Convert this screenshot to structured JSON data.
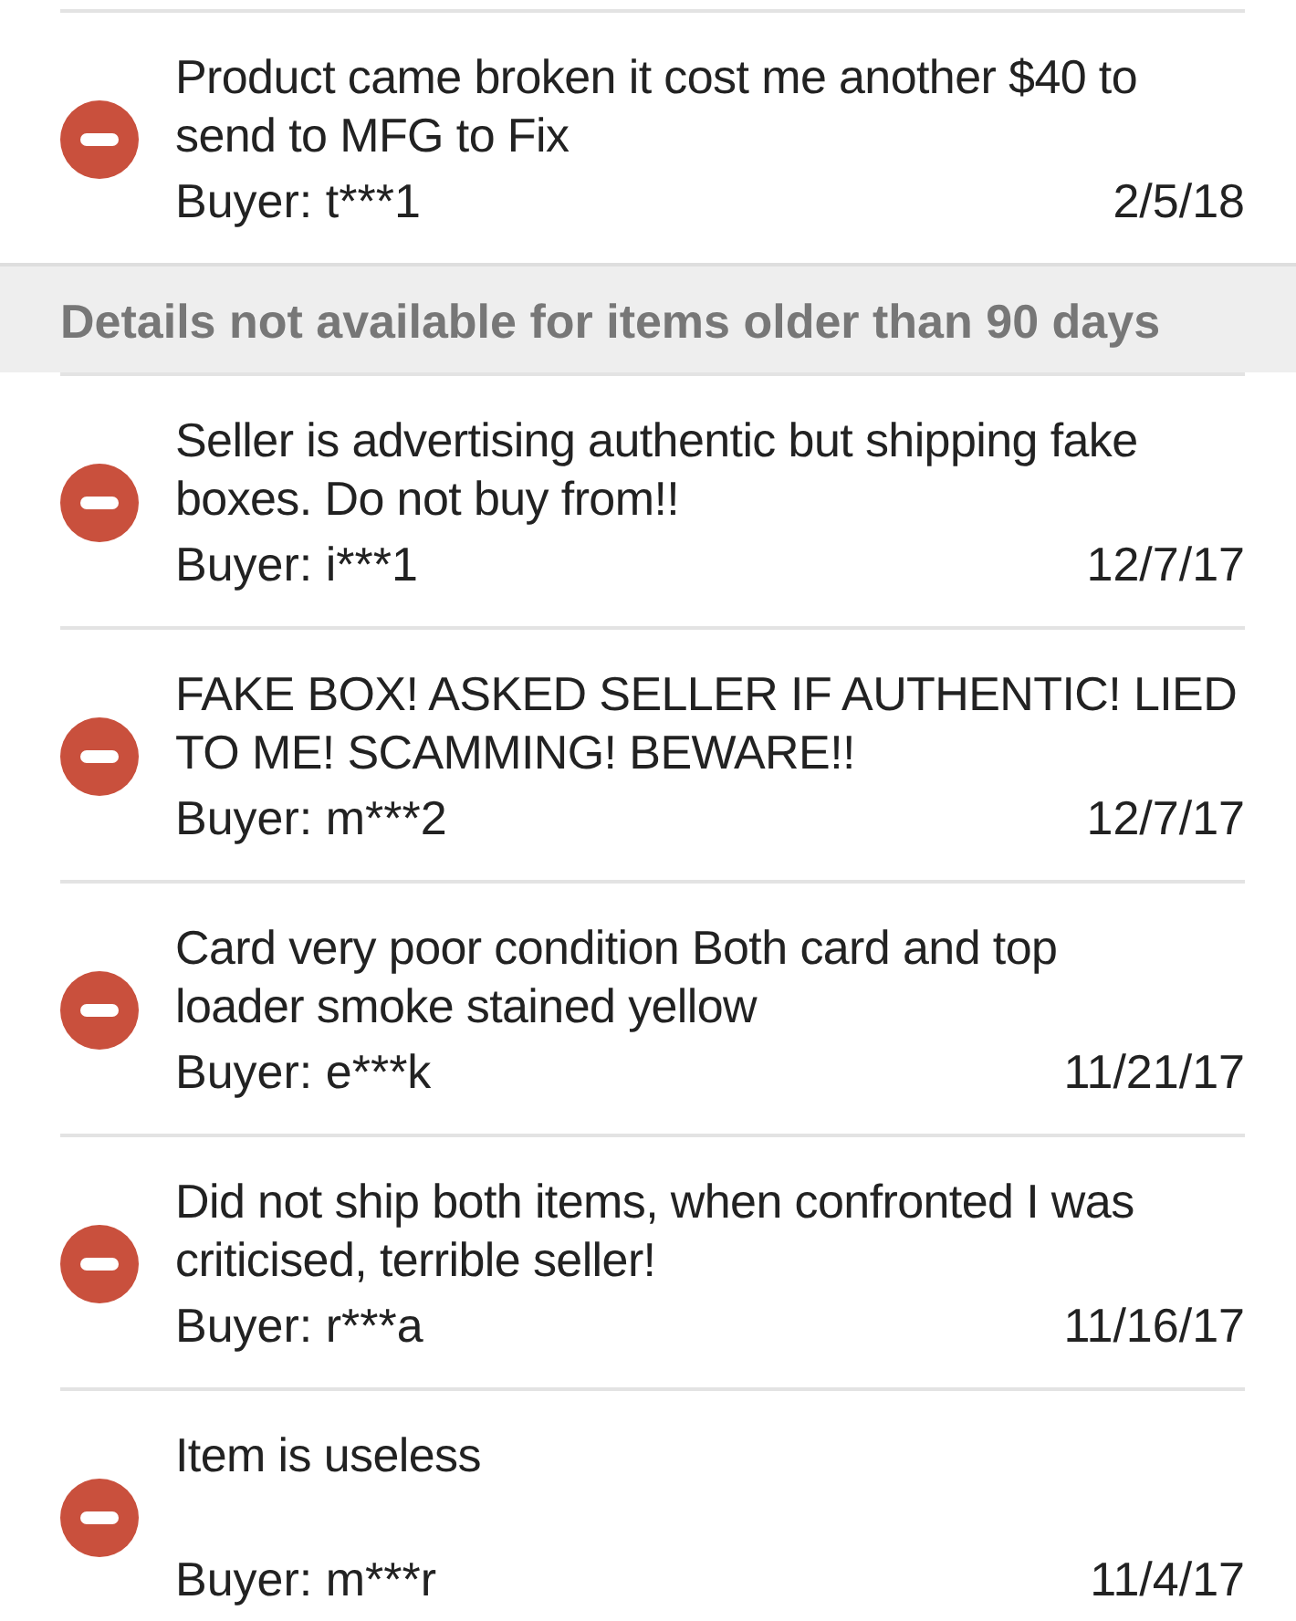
{
  "entries": [
    {
      "kind": "feedback",
      "negative": true,
      "message": "Product came broken it cost me another $40 to\nsend to MFG to Fix",
      "buyer": "Buyer: t***1",
      "date": "2/5/18"
    },
    {
      "kind": "notice",
      "text": "Details not available for items older than 90 days"
    },
    {
      "kind": "feedback",
      "negative": true,
      "message": "Seller is advertising authentic but shipping fake\nboxes. Do not buy from!!",
      "buyer": "Buyer: i***1",
      "date": "12/7/17"
    },
    {
      "kind": "feedback",
      "negative": true,
      "message": "FAKE BOX! ASKED SELLER IF AUTHENTIC! LIED\nTO ME! SCAMMING! BEWARE!!",
      "buyer": "Buyer: m***2",
      "date": "12/7/17"
    },
    {
      "kind": "feedback",
      "negative": true,
      "message": "Card very poor condition Both card and top\nloader smoke stained yellow",
      "buyer": "Buyer: e***k",
      "date": "11/21/17"
    },
    {
      "kind": "feedback",
      "negative": true,
      "message": "Did not ship both items, when confronted I was\ncriticised, terrible seller!",
      "buyer": "Buyer: r***a",
      "date": "11/16/17"
    },
    {
      "kind": "feedback",
      "negative": true,
      "message": "Item is useless",
      "buyer": "Buyer: m***r",
      "date": "11/4/17"
    }
  ]
}
